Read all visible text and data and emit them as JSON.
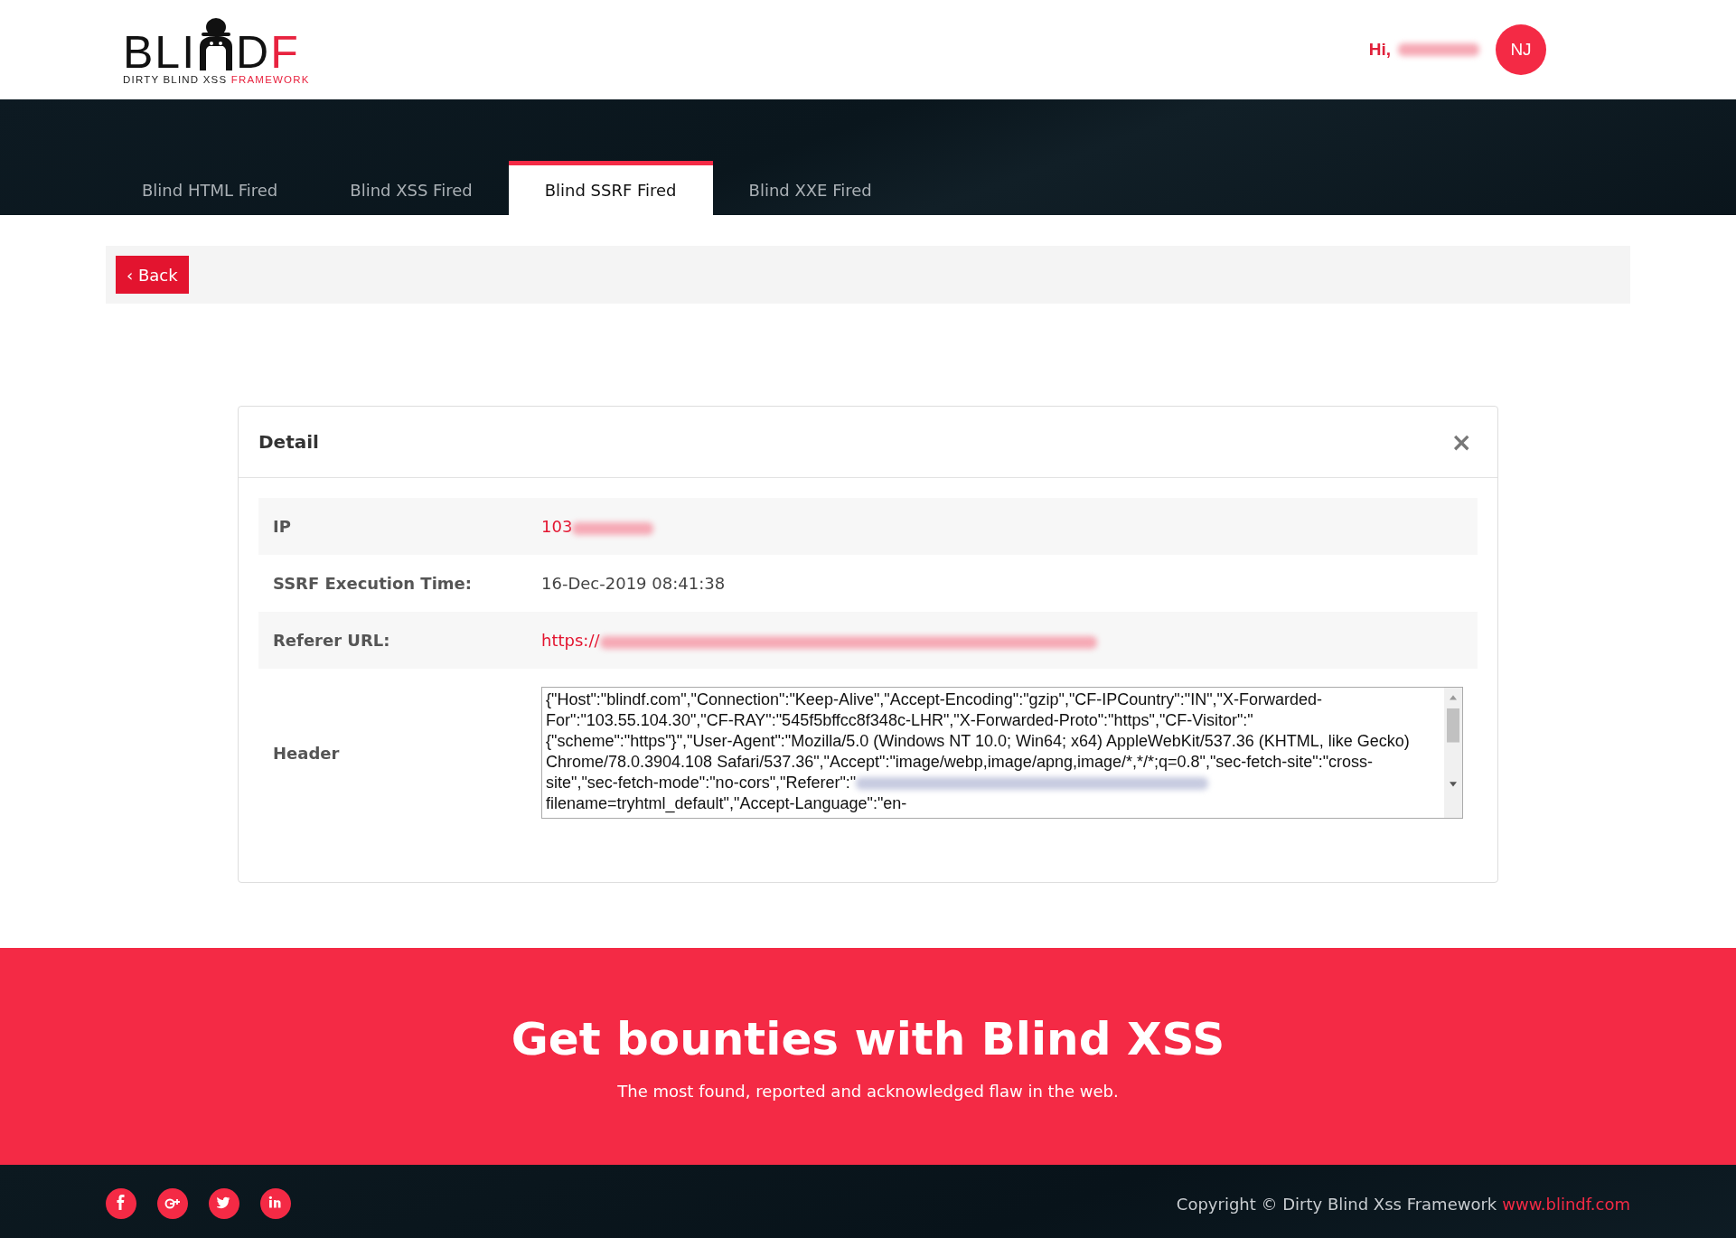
{
  "logo": {
    "wordmark_start": "BLI",
    "wordmark_end": "DF",
    "tagline": "DIRTY BLIND XSS",
    "tagline_accent": "FRAMEWORK"
  },
  "user": {
    "greeting": "Hi,",
    "initials": "NJ"
  },
  "tabs": [
    {
      "label": "Blind HTML Fired",
      "selected": false
    },
    {
      "label": "Blind XSS Fired",
      "selected": false
    },
    {
      "label": "Blind SSRF Fired",
      "selected": true
    },
    {
      "label": "Blind XXE Fired",
      "selected": false
    }
  ],
  "back_button": {
    "icon": "‹",
    "label": "Back"
  },
  "detail": {
    "title": "Detail",
    "close": "×",
    "rows": [
      {
        "kind": "text",
        "label": "IP",
        "value": "103",
        "redacted": true,
        "accent": true
      },
      {
        "kind": "text",
        "label": "SSRF Execution Time:",
        "value": "16-Dec-2019 08:41:38",
        "redacted": false,
        "accent": false
      },
      {
        "kind": "text",
        "label": "Referer URL:",
        "value": "https://",
        "redacted": true,
        "accent": true
      },
      {
        "kind": "textarea",
        "label": "Header",
        "value": "{\"Host\":\"blindf.com\",\"Connection\":\"Keep-Alive\",\"Accept-Encoding\":\"gzip\",\"CF-IPCountry\":\"IN\",\"X-Forwarded-For\":\"103.55.104.30\",\"CF-RAY\":\"545f5bffcc8f348c-LHR\",\"X-Forwarded-Proto\":\"https\",\"CF-Visitor\":\"{\"scheme\":\"https\"}\",\"User-Agent\":\"Mozilla/5.0 (Windows NT 10.0; Win64; x64) AppleWebKit/537.36 (KHTML, like Gecko) Chrome/78.0.3904.108 Safari/537.36\",\"Accept\":\"image/webp,image/apng,image/*,*/*;q=0.8\",\"sec-fetch-site\":\"cross-site\",\"sec-fetch-mode\":\"no-cors\",\"Referer\":\"",
        "value_continued": "filename=tryhtml_default\",\"Accept-Language\":\"en-",
        "redacted": true
      }
    ]
  },
  "banner": {
    "title": "Get bounties with Blind XSS",
    "subtitle": "The most found, reported and acknowledged flaw in the web."
  },
  "footer": {
    "social": [
      {
        "kind": "facebook"
      },
      {
        "kind": "googleplus"
      },
      {
        "kind": "twitter"
      },
      {
        "kind": "linkedin"
      }
    ],
    "copyright": "Copyright © Dirty Blind Xss Framework",
    "link": "www.blindf.com"
  }
}
